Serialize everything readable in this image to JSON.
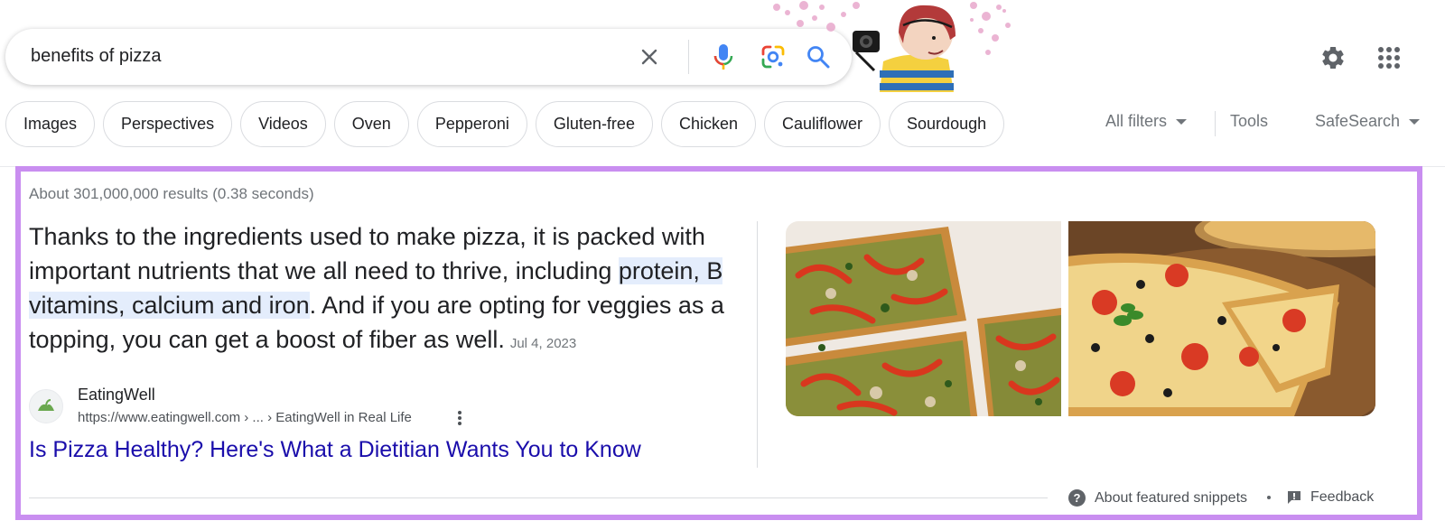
{
  "search": {
    "query": "benefits of pizza"
  },
  "chips": [
    "Images",
    "Perspectives",
    "Videos",
    "Oven",
    "Pepperoni",
    "Gluten-free",
    "Chicken",
    "Cauliflower",
    "Sourdough"
  ],
  "filters": {
    "all_filters": "All filters",
    "tools": "Tools",
    "safesearch": "SafeSearch"
  },
  "results": {
    "stats": "About 301,000,000 results (0.38 seconds)"
  },
  "snippet": {
    "text_before": "Thanks to the ingredients used to make pizza, it is packed with important nutrients that we all need to thrive, including ",
    "highlight": "protein, B vitamins, calcium and iron",
    "text_after": ". And if you are opting for veggies as a topping, you can get a boost of fiber as well.",
    "date": "Jul 4, 2023",
    "source_name": "EatingWell",
    "source_url": "https://www.eatingwell.com › ... › EatingWell in Real Life",
    "title": "Is Pizza Healthy? Here's What a Dietitian Wants You to Know"
  },
  "footer": {
    "about": "About featured snippets",
    "feedback": "Feedback"
  },
  "colors": {
    "highlight_border": "#c98ef0",
    "link_blue": "#1a0dab",
    "text_highlight": "#e4edfc"
  },
  "icons": [
    "clear-icon",
    "microphone-icon",
    "lens-icon",
    "search-icon",
    "settings-gear-icon",
    "apps-grid-icon",
    "help-icon",
    "feedback-icon",
    "more-vert-icon"
  ]
}
